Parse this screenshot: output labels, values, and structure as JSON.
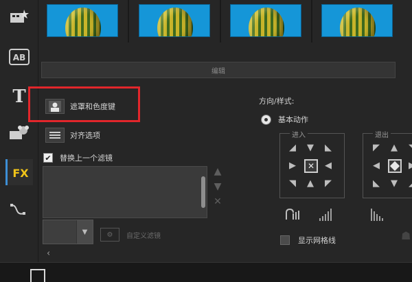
{
  "thumbnails": {
    "count": 4
  },
  "sidebar": {
    "items": [
      {
        "name": "instant-project-icon"
      },
      {
        "name": "transition-ab-icon",
        "label": "AB"
      },
      {
        "name": "title-t-icon",
        "label": "T"
      },
      {
        "name": "graphic-icon"
      },
      {
        "name": "fx-filter-icon",
        "label": "FX",
        "active": true
      },
      {
        "name": "path-icon"
      }
    ]
  },
  "edit_bar": {
    "label": "编辑"
  },
  "options": {
    "mask_chroma": "遮罩和色度键",
    "align": "对齐选项",
    "replace_filter": "替换上一个滤镜",
    "replace_filter_checked": true,
    "custom_filter": "自定义滤镜"
  },
  "direction": {
    "title": "方向/样式:",
    "basic_motion": "基本动作",
    "enter": "进入",
    "exit": "退出",
    "show_grid": "显示网格线"
  },
  "colors": {
    "accent": "#3d8fd6",
    "highlight": "#e2262b",
    "thumb_bg": "#1596d8"
  }
}
